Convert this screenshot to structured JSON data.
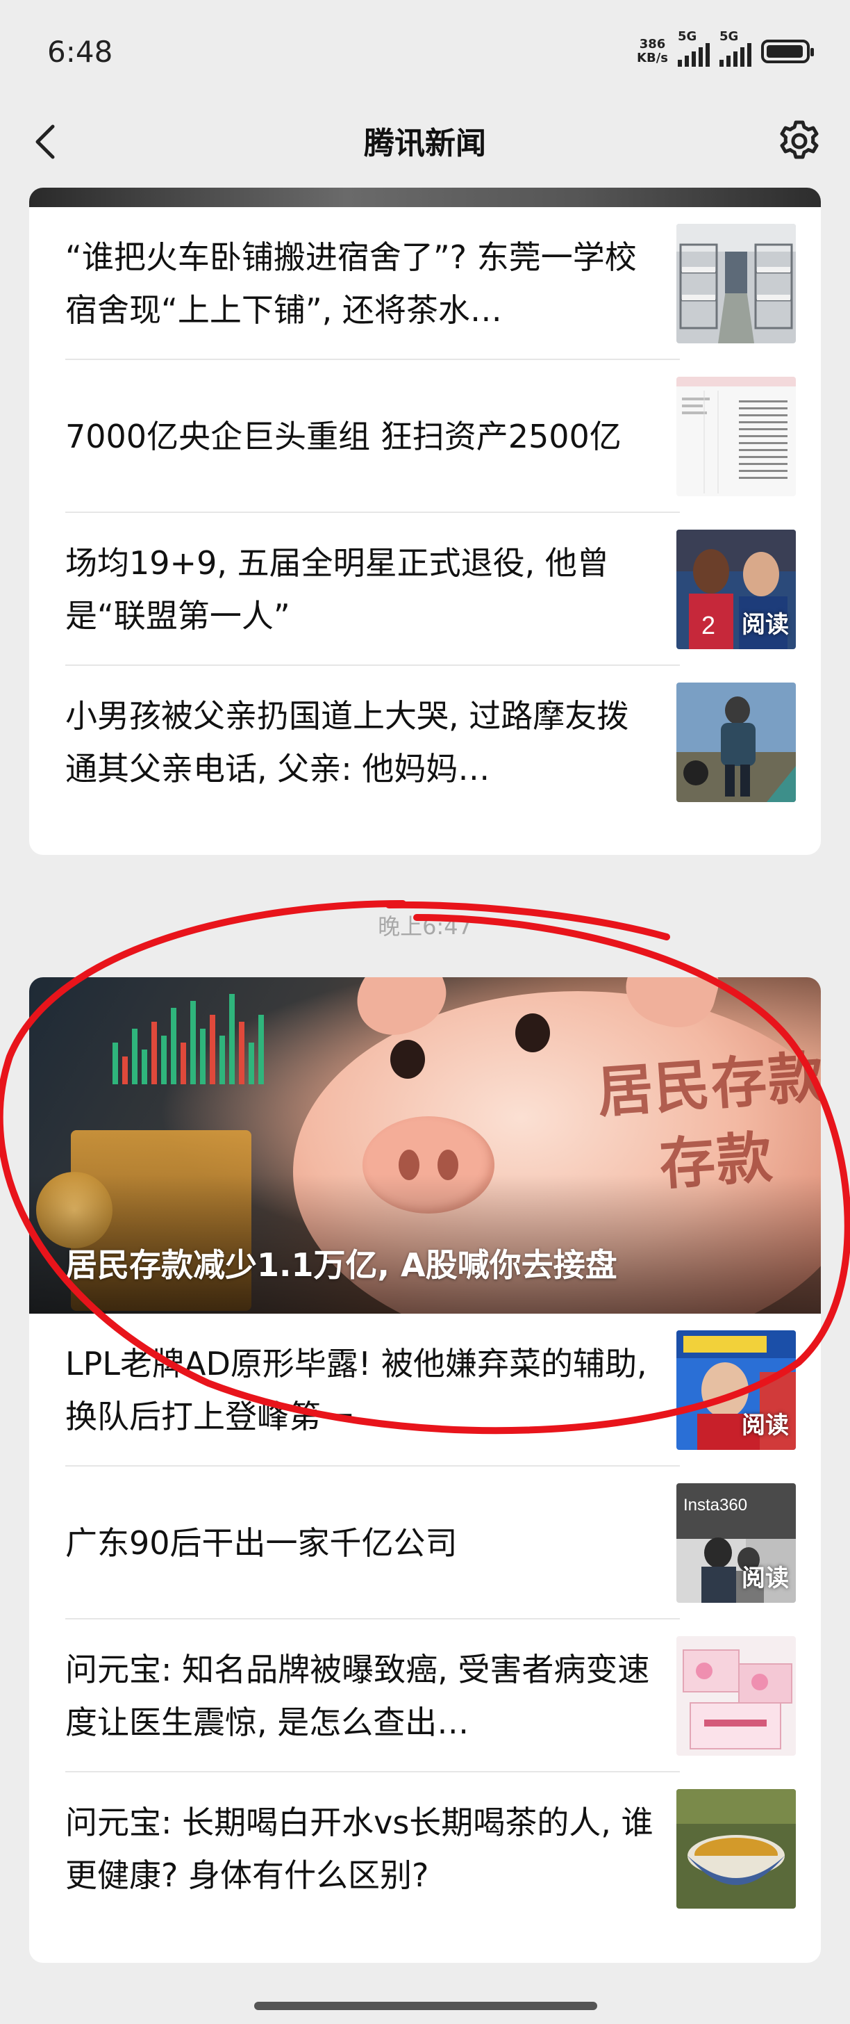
{
  "status_bar": {
    "time": "6:48",
    "net_speed_top": "386",
    "net_speed_bottom": "KB/s",
    "sim1_label": "5G",
    "sim2_label": "5G",
    "battery_icon": "battery-full-icon"
  },
  "header": {
    "title": "腾讯新闻",
    "back_icon": "chevron-left-icon",
    "settings_icon": "gear-icon"
  },
  "card1": {
    "items": [
      {
        "title": "“谁把火车卧铺搬进宿舍了”? 东莞一学校宿舍现“上上下铺”, 还将茶水…",
        "thumb": "dorm-bunk-beds-photo"
      },
      {
        "title": "7000亿央企巨头重组 狂扫资产2500亿",
        "thumb": "financial-data-table-image"
      },
      {
        "title": "场均19+9, 五届全明星正式退役, 他曾是“联盟第一人”",
        "thumb": "basketball-players-photo",
        "read_label": "阅读"
      },
      {
        "title": "小男孩被父亲扔国道上大哭, 过路摩友拨通其父亲电话, 父亲: 他妈妈…",
        "thumb": "roadside-boy-photo"
      }
    ]
  },
  "timestamp": "晚上6:47",
  "card2": {
    "hero": {
      "caption": "居民存款减少1.1万亿, A股喊你去接盘",
      "image_text_line1": "居民存款",
      "image_text_line2": "存款"
    },
    "items": [
      {
        "title": "LPL老牌AD原形毕露! 被他嫌弃菜的辅助, 换队后打上登峰第一",
        "thumb": "esports-player-photo",
        "read_label": "阅读"
      },
      {
        "title": "广东90后干出一家千亿公司",
        "thumb": "insta360-office-photo",
        "thumb_text": "Insta360",
        "read_label": "阅读"
      },
      {
        "title": "问元宝: 知名品牌被曝致癌, 受害者病变速度让医生震惊, 是怎么查出…",
        "thumb": "pink-product-boxes-photo"
      },
      {
        "title": "问元宝: 长期喝白开水vs长期喝茶的人, 谁更健康? 身体有什么区别?",
        "thumb": "tea-cup-photo"
      }
    ]
  },
  "colors": {
    "background": "#ededed",
    "card": "#ffffff",
    "annotation_circle": "#e8141b"
  }
}
